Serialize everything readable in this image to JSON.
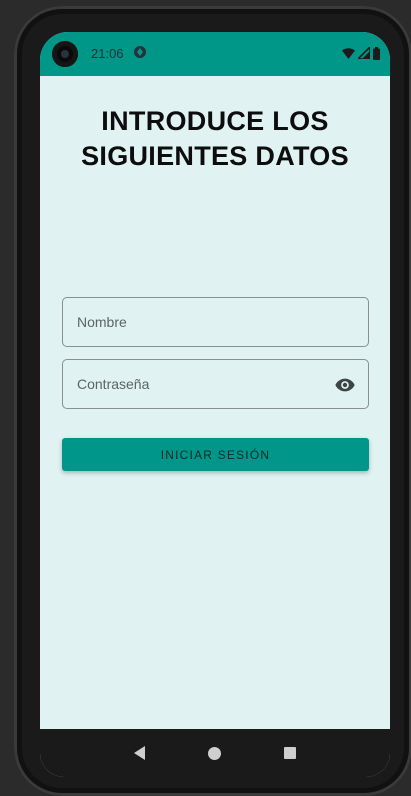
{
  "status_bar": {
    "time": "21:06",
    "icons": [
      "notification-icon",
      "wifi-icon",
      "signal-icon",
      "battery-icon"
    ],
    "color": "#009688"
  },
  "screen": {
    "title": "INTRODUCE LOS SIGUIENTES DATOS",
    "background": "#e0f2f1"
  },
  "form": {
    "name_placeholder": "Nombre",
    "password_placeholder": "Contraseña",
    "login_label": "INICIAR SESIÓN",
    "accent": "#00968a"
  },
  "nav_bar": {
    "buttons": [
      "back-icon",
      "home-icon",
      "recents-icon"
    ]
  }
}
